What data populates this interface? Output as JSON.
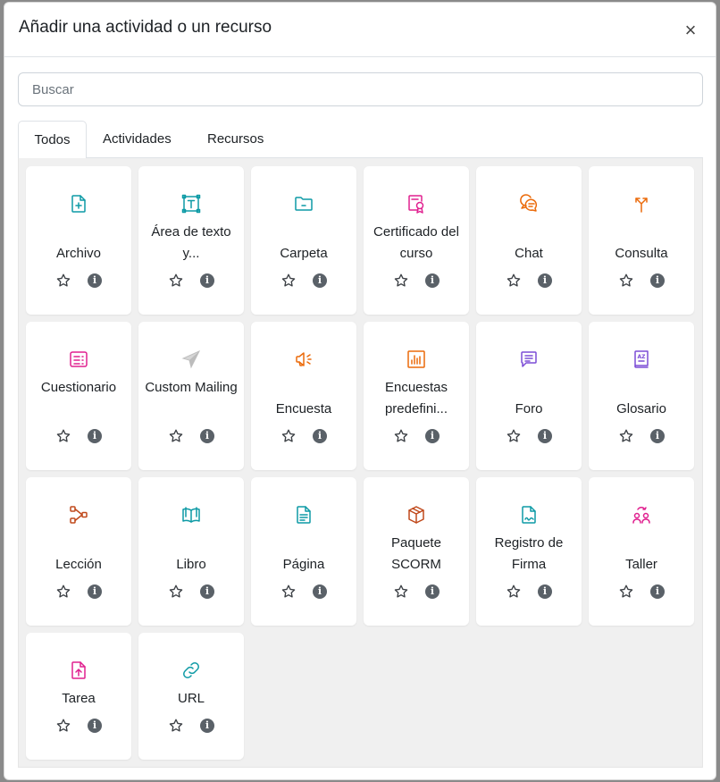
{
  "modal": {
    "title": "Añadir una actividad o un recurso",
    "close_icon": "×"
  },
  "search": {
    "placeholder": "Buscar"
  },
  "tabs": [
    {
      "label": "Todos",
      "active": true
    },
    {
      "label": "Actividades",
      "active": false
    },
    {
      "label": "Recursos",
      "active": false
    }
  ],
  "info_glyph": "i",
  "colors": {
    "teal": "#0d9aa5",
    "pink": "#e0208f",
    "orange": "#eb6a0a",
    "purple": "#7c4dd6",
    "rust": "#c0491b"
  },
  "items": [
    {
      "label": "Archivo",
      "icon": "file-plus-icon",
      "color": "#0d9aa5"
    },
    {
      "label": "Área de texto y...",
      "icon": "text-area-icon",
      "color": "#0d9aa5"
    },
    {
      "label": "Carpeta",
      "icon": "folder-icon",
      "color": "#0d9aa5"
    },
    {
      "label": "Certificado del curso",
      "icon": "certificate-icon",
      "color": "#e0208f"
    },
    {
      "label": "Chat",
      "icon": "chat-icon",
      "color": "#eb6a0a"
    },
    {
      "label": "Consulta",
      "icon": "choice-icon",
      "color": "#eb6a0a"
    },
    {
      "label": "Cuestionario",
      "icon": "quiz-icon",
      "color": "#e0208f"
    },
    {
      "label": "Custom Mailing",
      "icon": "paper-plane-icon",
      "color": "#c6c6c6"
    },
    {
      "label": "Encuesta",
      "icon": "megaphone-icon",
      "color": "#eb6a0a"
    },
    {
      "label": "Encuestas predefini...",
      "icon": "bar-chart-icon",
      "color": "#eb6a0a"
    },
    {
      "label": "Foro",
      "icon": "forum-icon",
      "color": "#7c4dd6"
    },
    {
      "label": "Glosario",
      "icon": "glossary-icon",
      "color": "#7c4dd6"
    },
    {
      "label": "Lección",
      "icon": "lesson-icon",
      "color": "#c0491b"
    },
    {
      "label": "Libro",
      "icon": "book-icon",
      "color": "#0d9aa5"
    },
    {
      "label": "Página",
      "icon": "page-icon",
      "color": "#0d9aa5"
    },
    {
      "label": "Paquete SCORM",
      "icon": "package-icon",
      "color": "#c0491b"
    },
    {
      "label": "Registro de Firma",
      "icon": "signature-icon",
      "color": "#0d9aa5"
    },
    {
      "label": "Taller",
      "icon": "workshop-icon",
      "color": "#e0208f"
    },
    {
      "label": "Tarea",
      "icon": "assignment-upload-icon",
      "color": "#e0208f"
    },
    {
      "label": "URL",
      "icon": "link-icon",
      "color": "#0d9aa5"
    }
  ]
}
